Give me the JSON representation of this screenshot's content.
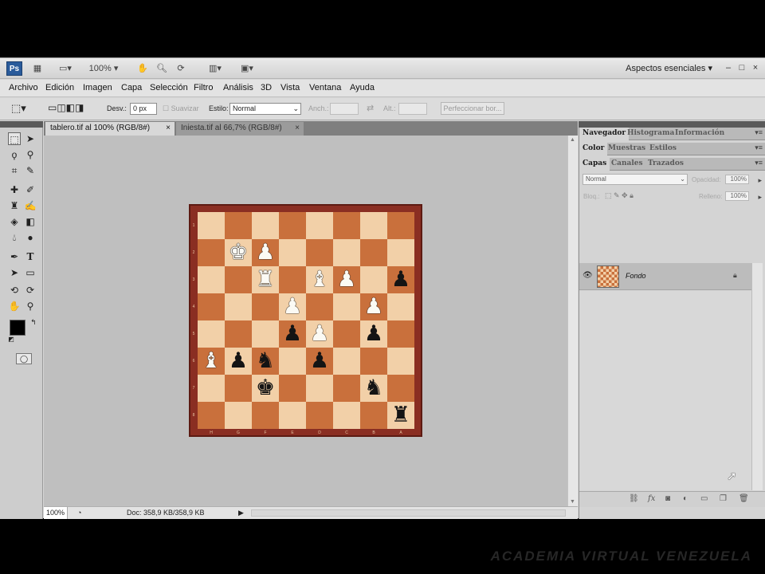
{
  "app": {
    "logo": "Ps",
    "zoom": "100%",
    "workspace": "Aspectos esenciales",
    "window_controls": [
      "–",
      "□",
      "×"
    ]
  },
  "menu": [
    "Archivo",
    "Edición",
    "Imagen",
    "Capa",
    "Selección",
    "Filtro",
    "Análisis",
    "3D",
    "Vista",
    "Ventana",
    "Ayuda"
  ],
  "options": {
    "feather_label": "Desv.:",
    "feather_value": "0 px",
    "antialias_label": "Suavizar",
    "style_label": "Estilo:",
    "style_value": "Normal",
    "width_label": "Anch.:",
    "height_label": "Alt.:",
    "refine_button": "Perfeccionar bor..."
  },
  "tabs": [
    {
      "label": "tablero.tif al 100% (RGB/8#)",
      "active": true
    },
    {
      "label": "Iniesta.tif al 66,7% (RGB/8#)",
      "active": false
    }
  ],
  "status": {
    "zoom": "100%",
    "doc": "Doc: 358,9 KB/358,9 KB"
  },
  "board": {
    "rank_labels": [
      "1",
      "2",
      "3",
      "4",
      "5",
      "6",
      "7",
      "8"
    ],
    "file_labels": [
      "H",
      "G",
      "F",
      "E",
      "D",
      "C",
      "B",
      "A"
    ],
    "pieces": [
      {
        "row": 1,
        "col": 1,
        "glyph": "♚",
        "color": "white"
      },
      {
        "row": 1,
        "col": 2,
        "glyph": "♟",
        "color": "white"
      },
      {
        "row": 2,
        "col": 2,
        "glyph": "♜",
        "color": "white"
      },
      {
        "row": 2,
        "col": 4,
        "glyph": "♝",
        "color": "white"
      },
      {
        "row": 2,
        "col": 5,
        "glyph": "♟",
        "color": "white"
      },
      {
        "row": 2,
        "col": 7,
        "glyph": "♟",
        "color": "black"
      },
      {
        "row": 3,
        "col": 3,
        "glyph": "♟",
        "color": "white"
      },
      {
        "row": 3,
        "col": 6,
        "glyph": "♟",
        "color": "white"
      },
      {
        "row": 4,
        "col": 3,
        "glyph": "♟",
        "color": "black"
      },
      {
        "row": 4,
        "col": 4,
        "glyph": "♟",
        "color": "white"
      },
      {
        "row": 4,
        "col": 6,
        "glyph": "♟",
        "color": "black"
      },
      {
        "row": 5,
        "col": 0,
        "glyph": "♝",
        "color": "white"
      },
      {
        "row": 5,
        "col": 1,
        "glyph": "♟",
        "color": "black"
      },
      {
        "row": 5,
        "col": 2,
        "glyph": "♞",
        "color": "black"
      },
      {
        "row": 5,
        "col": 4,
        "glyph": "♟",
        "color": "black"
      },
      {
        "row": 6,
        "col": 2,
        "glyph": "♚",
        "color": "black"
      },
      {
        "row": 6,
        "col": 6,
        "glyph": "♞",
        "color": "black"
      },
      {
        "row": 7,
        "col": 7,
        "glyph": "♜",
        "color": "black"
      }
    ]
  },
  "panels": {
    "group1": [
      "Navegador",
      "Histograma",
      "Información"
    ],
    "group2": [
      "Color",
      "Muestras",
      "Estilos"
    ],
    "group3": [
      "Capas",
      "Canales",
      "Trazados"
    ],
    "blend_mode": "Normal",
    "opacity_label": "Opacidad:",
    "opacity_value": "100%",
    "lock_label": "Bloq.:",
    "fill_label": "Relleno:",
    "fill_value": "100%",
    "layer_name": "Fondo"
  },
  "watermark": "ACADEMIA VIRTUAL VENEZUELA",
  "colors": {
    "board_border": "#8a2e22",
    "light_square": "#f2d0a8",
    "dark_square": "#c9703c",
    "canvas_bg": "#bfbfbf"
  }
}
